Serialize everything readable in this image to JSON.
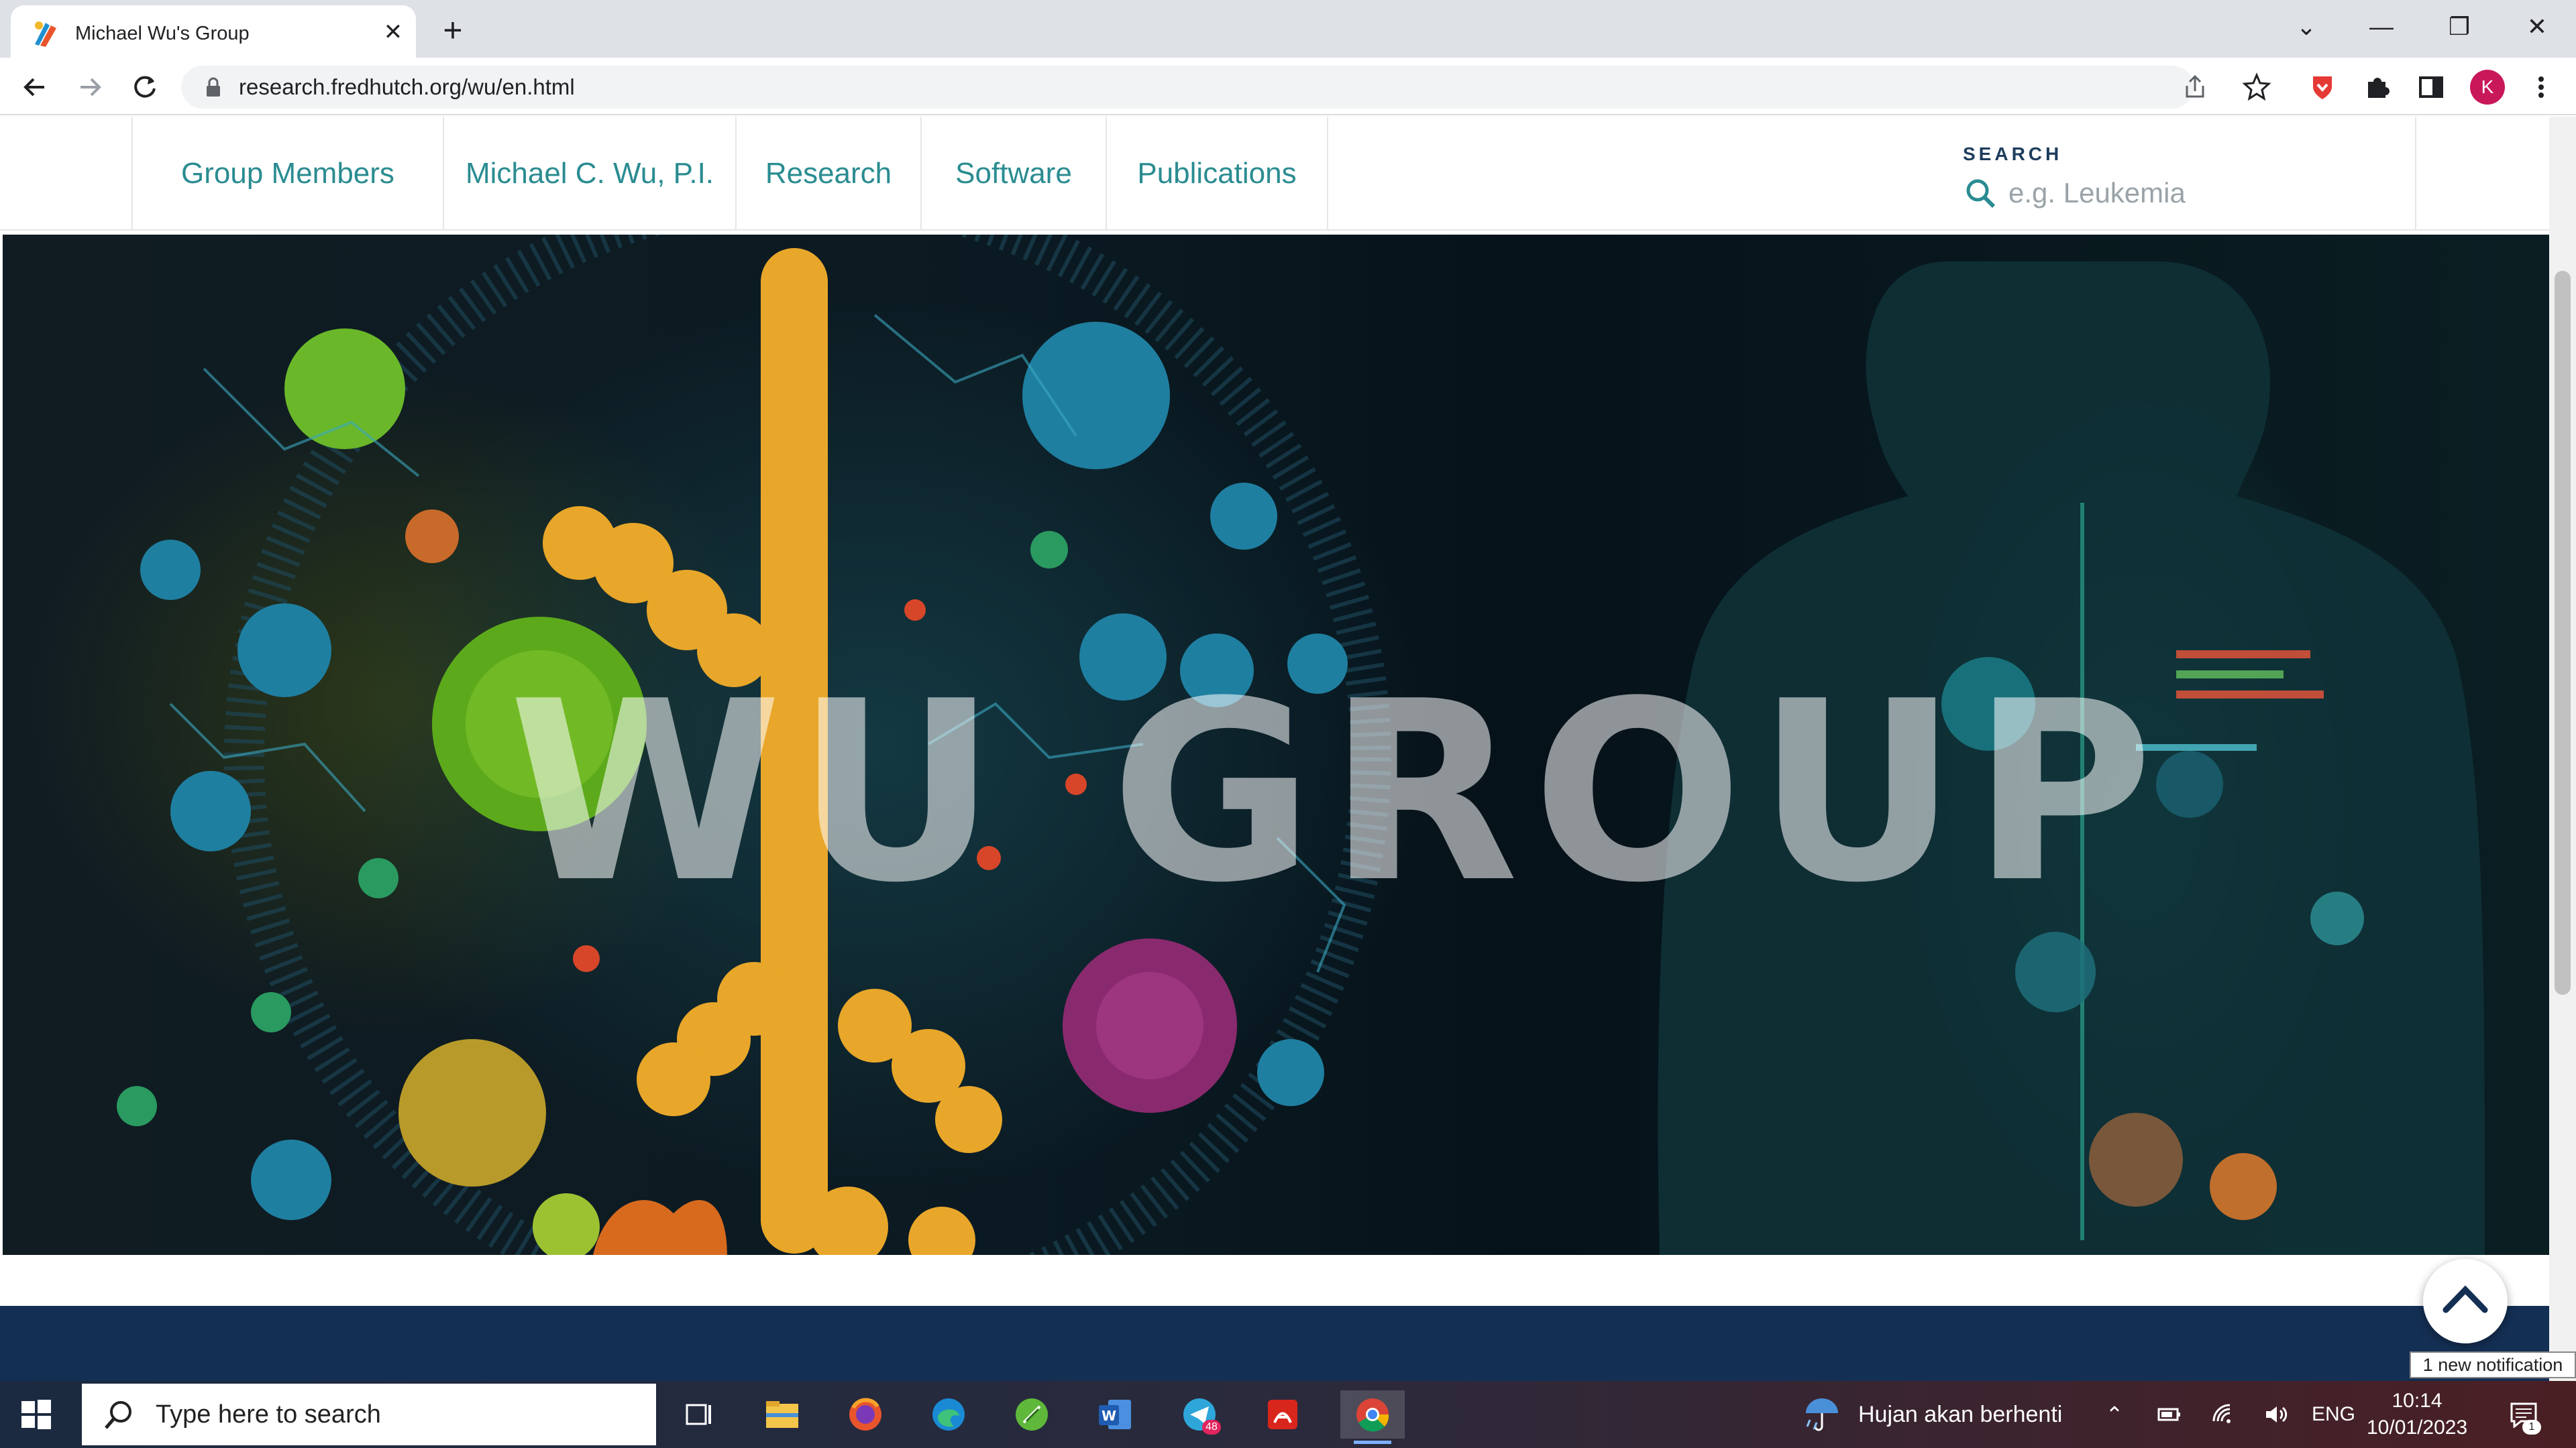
{
  "browser": {
    "tab_title": "Michael Wu's Group",
    "tab_close": "✕",
    "new_tab": "+",
    "url": "research.fredhutch.org/wu/en.html",
    "profile_initial": "K",
    "window_controls": {
      "dropdown": "⌄",
      "minimize": "—",
      "restore": "❐",
      "close": "✕"
    }
  },
  "site": {
    "nav_items": [
      {
        "label": "Group Members"
      },
      {
        "label": "Michael C. Wu, P.I."
      },
      {
        "label": "Research"
      },
      {
        "label": "Software"
      },
      {
        "label": "Publications"
      }
    ],
    "search": {
      "label": "SEARCH",
      "placeholder": "e.g. Leukemia"
    },
    "hero": {
      "title": "WU GROUP"
    }
  },
  "notification": {
    "text": "1 new notification"
  },
  "taskbar": {
    "search_placeholder": "Type here to search",
    "weather_text": "Hujan akan berhenti",
    "language": "ENG",
    "time": "10:14",
    "date": "10/01/2023",
    "telegram_badge": "48",
    "notification_count": "1"
  },
  "colors": {
    "nav_text": "#2a8c91",
    "footer_band": "#142f54",
    "profile_avatar": "#c8185a"
  }
}
